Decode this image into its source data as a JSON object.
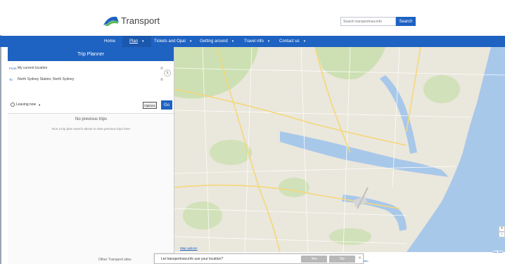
{
  "header": {
    "logo_text": "Transport",
    "search_placeholder": "Search transportnsw.info",
    "search_button": "Search"
  },
  "nav": {
    "items": [
      {
        "label": "Home",
        "dropdown": false
      },
      {
        "label": "Plan",
        "dropdown": true,
        "active": true
      },
      {
        "label": "Tickets and Opal",
        "dropdown": true
      },
      {
        "label": "Getting around",
        "dropdown": true
      },
      {
        "label": "Travel info",
        "dropdown": true
      },
      {
        "label": "Contact us",
        "dropdown": true
      }
    ],
    "caret": "▾"
  },
  "trip_planner": {
    "title": "Trip Planner",
    "from_tag": "From",
    "from_value": "My current location",
    "to_tag": "To",
    "to_value": "North Sydney Station, North Sydney",
    "leaving": "Leaving now",
    "options_button": "Options",
    "go_button": "Go",
    "no_trips_title": "No previous trips",
    "no_trips_hint": "Run a trip plan search above to view previous trips here"
  },
  "map": {
    "options_link": "Map options",
    "zoom_in": "+",
    "zoom_out": "−",
    "attribution": "Map data",
    "colors": {
      "land": "#eae7dc",
      "park": "#c6dea9",
      "water": "#a8c8ea",
      "road": "#ffffff",
      "major_road": "#f5d77a"
    }
  },
  "footer": {
    "other_sites": "Other Transport sites",
    "right_link": "info"
  },
  "location_prompt": {
    "text": "Let transportnsw.info use your location?",
    "yes": "Yes",
    "no": "No",
    "close": "✕"
  },
  "colors": {
    "brand_blue": "#1e62c2"
  }
}
